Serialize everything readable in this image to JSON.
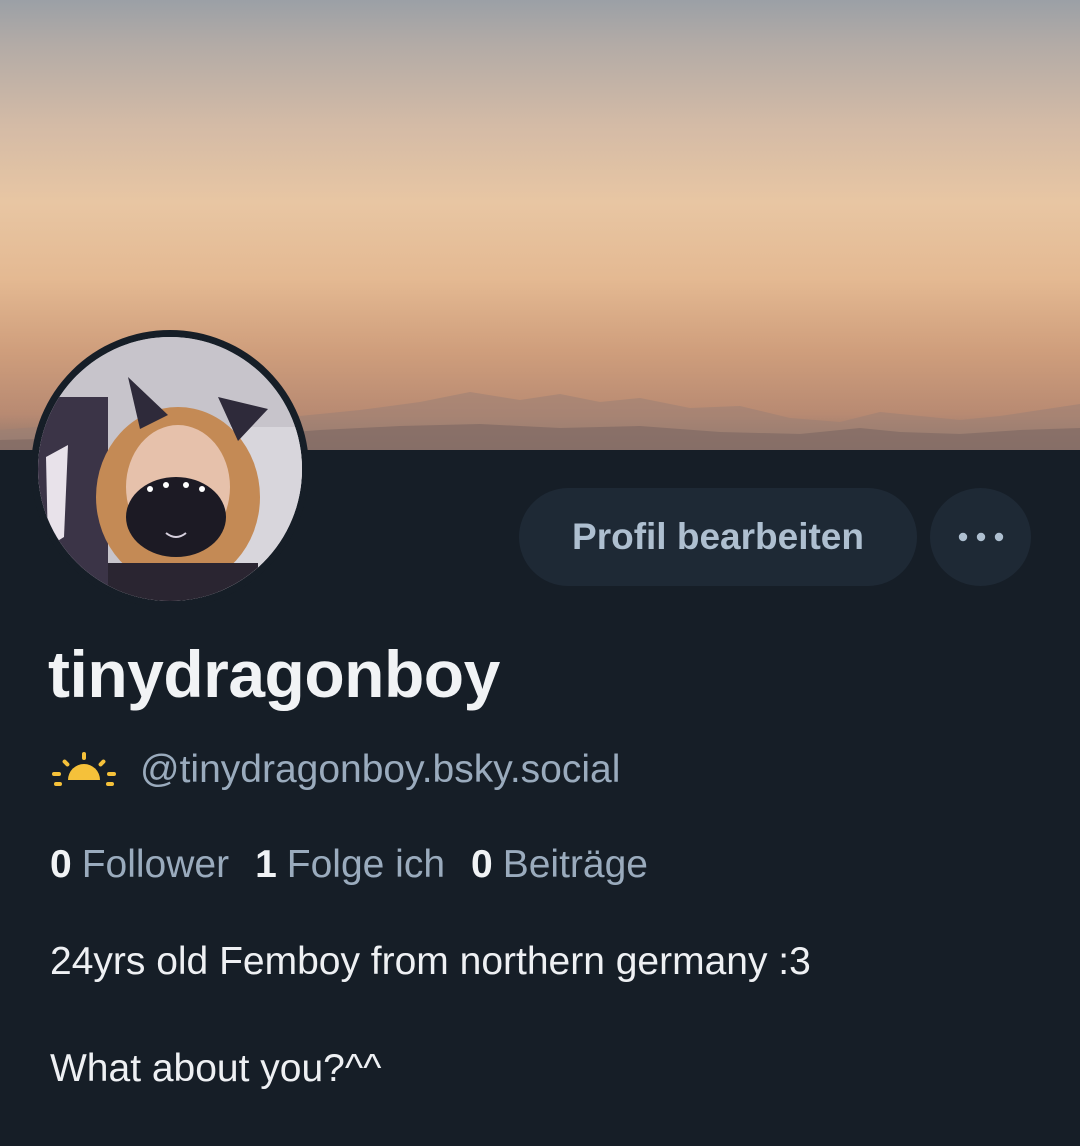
{
  "profile": {
    "display_name": "tinydragonboy",
    "handle": "@tinydragonboy.bsky.social",
    "handle_emoji_icon": "sunrise-icon",
    "avatar_icon": "profile-photo",
    "stats": [
      {
        "value": "0",
        "label": "Follower"
      },
      {
        "value": "1",
        "label": "Folge ich"
      },
      {
        "value": "0",
        "label": "Beiträge"
      }
    ],
    "bio": [
      "24yrs old Femboy from northern germany :3",
      "What about you?^^"
    ]
  },
  "actions": {
    "edit_label": "Profil bearbeiten",
    "more_icon": "ellipsis-icon"
  },
  "colors": {
    "background": "#161e27",
    "button_bg": "#1e2935",
    "button_text": "#aebfd0",
    "secondary_text": "#9aabbd",
    "primary_text": "#f1f3f5"
  }
}
